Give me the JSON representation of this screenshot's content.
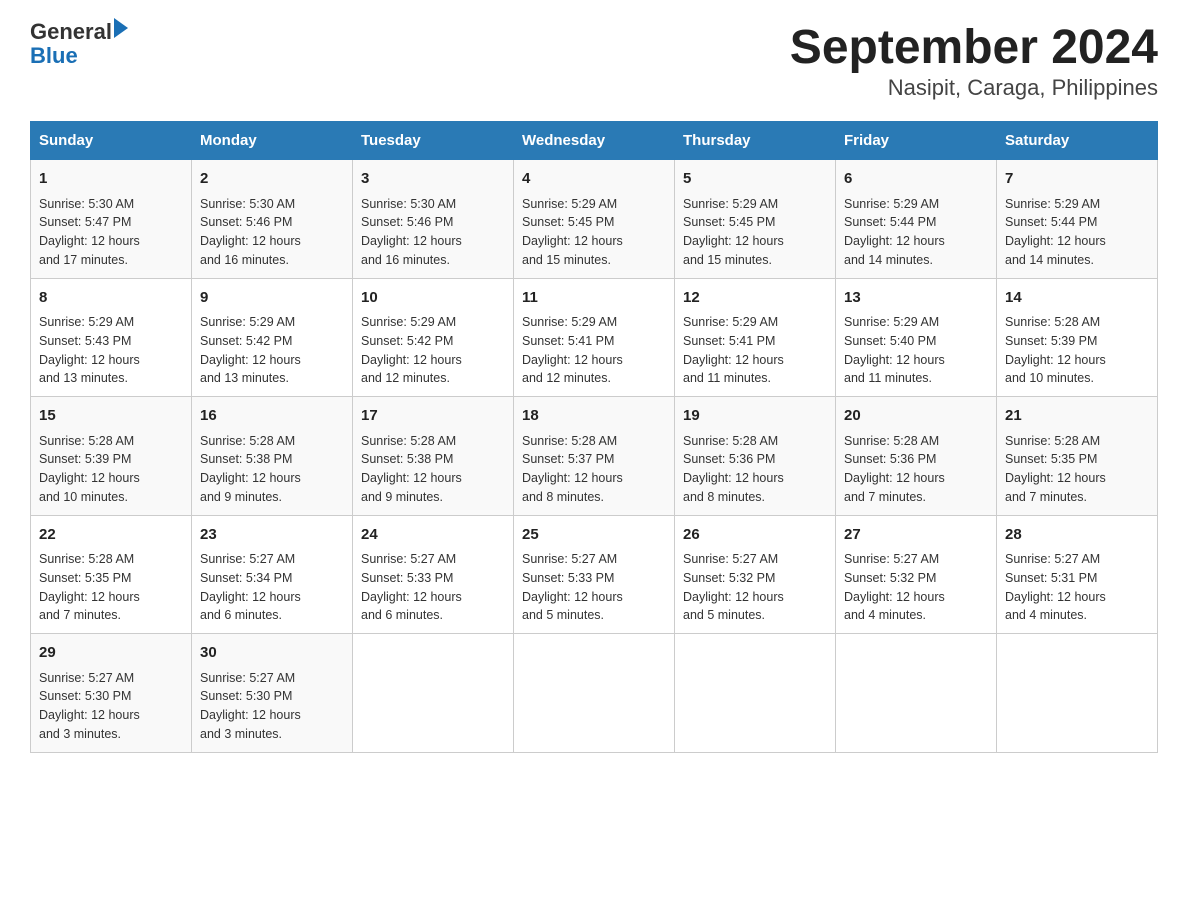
{
  "logo": {
    "text_general": "General",
    "text_blue": "Blue",
    "arrow": true
  },
  "title": "September 2024",
  "subtitle": "Nasipit, Caraga, Philippines",
  "weekdays": [
    "Sunday",
    "Monday",
    "Tuesday",
    "Wednesday",
    "Thursday",
    "Friday",
    "Saturday"
  ],
  "weeks": [
    [
      {
        "day": "1",
        "sunrise": "5:30 AM",
        "sunset": "5:47 PM",
        "daylight": "12 hours and 17 minutes."
      },
      {
        "day": "2",
        "sunrise": "5:30 AM",
        "sunset": "5:46 PM",
        "daylight": "12 hours and 16 minutes."
      },
      {
        "day": "3",
        "sunrise": "5:30 AM",
        "sunset": "5:46 PM",
        "daylight": "12 hours and 16 minutes."
      },
      {
        "day": "4",
        "sunrise": "5:29 AM",
        "sunset": "5:45 PM",
        "daylight": "12 hours and 15 minutes."
      },
      {
        "day": "5",
        "sunrise": "5:29 AM",
        "sunset": "5:45 PM",
        "daylight": "12 hours and 15 minutes."
      },
      {
        "day": "6",
        "sunrise": "5:29 AM",
        "sunset": "5:44 PM",
        "daylight": "12 hours and 14 minutes."
      },
      {
        "day": "7",
        "sunrise": "5:29 AM",
        "sunset": "5:44 PM",
        "daylight": "12 hours and 14 minutes."
      }
    ],
    [
      {
        "day": "8",
        "sunrise": "5:29 AM",
        "sunset": "5:43 PM",
        "daylight": "12 hours and 13 minutes."
      },
      {
        "day": "9",
        "sunrise": "5:29 AM",
        "sunset": "5:42 PM",
        "daylight": "12 hours and 13 minutes."
      },
      {
        "day": "10",
        "sunrise": "5:29 AM",
        "sunset": "5:42 PM",
        "daylight": "12 hours and 12 minutes."
      },
      {
        "day": "11",
        "sunrise": "5:29 AM",
        "sunset": "5:41 PM",
        "daylight": "12 hours and 12 minutes."
      },
      {
        "day": "12",
        "sunrise": "5:29 AM",
        "sunset": "5:41 PM",
        "daylight": "12 hours and 11 minutes."
      },
      {
        "day": "13",
        "sunrise": "5:29 AM",
        "sunset": "5:40 PM",
        "daylight": "12 hours and 11 minutes."
      },
      {
        "day": "14",
        "sunrise": "5:28 AM",
        "sunset": "5:39 PM",
        "daylight": "12 hours and 10 minutes."
      }
    ],
    [
      {
        "day": "15",
        "sunrise": "5:28 AM",
        "sunset": "5:39 PM",
        "daylight": "12 hours and 10 minutes."
      },
      {
        "day": "16",
        "sunrise": "5:28 AM",
        "sunset": "5:38 PM",
        "daylight": "12 hours and 9 minutes."
      },
      {
        "day": "17",
        "sunrise": "5:28 AM",
        "sunset": "5:38 PM",
        "daylight": "12 hours and 9 minutes."
      },
      {
        "day": "18",
        "sunrise": "5:28 AM",
        "sunset": "5:37 PM",
        "daylight": "12 hours and 8 minutes."
      },
      {
        "day": "19",
        "sunrise": "5:28 AM",
        "sunset": "5:36 PM",
        "daylight": "12 hours and 8 minutes."
      },
      {
        "day": "20",
        "sunrise": "5:28 AM",
        "sunset": "5:36 PM",
        "daylight": "12 hours and 7 minutes."
      },
      {
        "day": "21",
        "sunrise": "5:28 AM",
        "sunset": "5:35 PM",
        "daylight": "12 hours and 7 minutes."
      }
    ],
    [
      {
        "day": "22",
        "sunrise": "5:28 AM",
        "sunset": "5:35 PM",
        "daylight": "12 hours and 7 minutes."
      },
      {
        "day": "23",
        "sunrise": "5:27 AM",
        "sunset": "5:34 PM",
        "daylight": "12 hours and 6 minutes."
      },
      {
        "day": "24",
        "sunrise": "5:27 AM",
        "sunset": "5:33 PM",
        "daylight": "12 hours and 6 minutes."
      },
      {
        "day": "25",
        "sunrise": "5:27 AM",
        "sunset": "5:33 PM",
        "daylight": "12 hours and 5 minutes."
      },
      {
        "day": "26",
        "sunrise": "5:27 AM",
        "sunset": "5:32 PM",
        "daylight": "12 hours and 5 minutes."
      },
      {
        "day": "27",
        "sunrise": "5:27 AM",
        "sunset": "5:32 PM",
        "daylight": "12 hours and 4 minutes."
      },
      {
        "day": "28",
        "sunrise": "5:27 AM",
        "sunset": "5:31 PM",
        "daylight": "12 hours and 4 minutes."
      }
    ],
    [
      {
        "day": "29",
        "sunrise": "5:27 AM",
        "sunset": "5:30 PM",
        "daylight": "12 hours and 3 minutes."
      },
      {
        "day": "30",
        "sunrise": "5:27 AM",
        "sunset": "5:30 PM",
        "daylight": "12 hours and 3 minutes."
      },
      null,
      null,
      null,
      null,
      null
    ]
  ],
  "labels": {
    "sunrise": "Sunrise:",
    "sunset": "Sunset:",
    "daylight": "Daylight:"
  }
}
